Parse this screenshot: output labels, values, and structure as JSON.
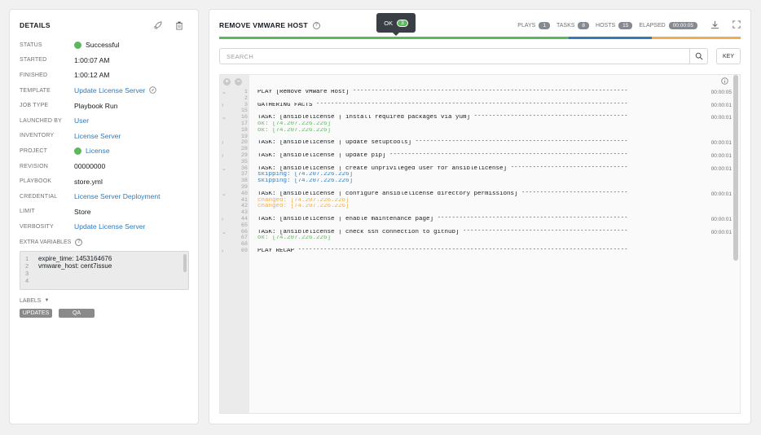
{
  "details": {
    "title": "DETAILS",
    "rows": [
      {
        "label": "STATUS",
        "value": "Successful",
        "type": "status"
      },
      {
        "label": "STARTED",
        "value": "1:00:07 AM",
        "type": "text"
      },
      {
        "label": "FINISHED",
        "value": "1:00:12 AM",
        "type": "text"
      },
      {
        "label": "TEMPLATE",
        "value": "Update License Server",
        "type": "link-compass"
      },
      {
        "label": "JOB TYPE",
        "value": "Playbook Run",
        "type": "text"
      },
      {
        "label": "LAUNCHED BY",
        "value": "User",
        "type": "link"
      },
      {
        "label": "INVENTORY",
        "value": "License Server",
        "type": "link"
      },
      {
        "label": "PROJECT",
        "value": "License",
        "type": "link-status"
      },
      {
        "label": "REVISION",
        "value": "00000000",
        "type": "text"
      },
      {
        "label": "PLAYBOOK",
        "value": "store.yml",
        "type": "text"
      },
      {
        "label": "CREDENTIAL",
        "value": "License Server Deployment",
        "type": "link"
      },
      {
        "label": "LIMIT",
        "value": "Store",
        "type": "text"
      },
      {
        "label": "VERBOSITY",
        "value": "Update License Server",
        "type": "link"
      }
    ],
    "extra_variables_label": "EXTRA VARIABLES",
    "extra_variables": [
      {
        "ln": "1",
        "text": "expire_time: 1453164676"
      },
      {
        "ln": "2",
        "text": "vmware_host: cent7issue"
      },
      {
        "ln": "3",
        "text": ""
      },
      {
        "ln": "4",
        "text": ""
      }
    ],
    "labels_title": "LABELS",
    "labels": [
      "UPDATES",
      "QA"
    ]
  },
  "output": {
    "title": "REMOVE VMWARE HOST",
    "tooltip": {
      "label": "OK",
      "count": "3"
    },
    "plays_label": "PLAYS",
    "plays": "1",
    "tasks_label": "TASKS",
    "tasks": "8",
    "hosts_label": "HOSTS",
    "hosts": "15",
    "elapsed_label": "ELAPSED",
    "elapsed": "00:00:05",
    "search_placeholder": "SEARCH",
    "key_label": "KEY",
    "colors": {
      "ok": "#5cb85c",
      "skipped": "#337ab7",
      "changed": "#f0ad4e"
    },
    "progress": [
      {
        "status": "ok",
        "fraction": 0.67
      },
      {
        "status": "skipped",
        "fraction": 0.16
      },
      {
        "status": "changed",
        "fraction": 0.17
      }
    ],
    "lines": [
      {
        "chev": "⌄",
        "ln": "1",
        "text": "PLAY [Remove VMWare Host] ***************************************************************************",
        "time": "00:00:05",
        "cls": ""
      },
      {
        "chev": "",
        "ln": "2",
        "text": "",
        "time": "",
        "cls": ""
      },
      {
        "chev": "›",
        "ln": "3",
        "text": "GATHERING FACTS *************************************************************************************",
        "time": "00:00:01",
        "cls": ""
      },
      {
        "chev": "",
        "ln": "15",
        "text": "",
        "time": "",
        "cls": ""
      },
      {
        "chev": "⌄",
        "ln": "16",
        "text": "TASK: [ansiblelicense | install required packages via yum] ******************************************",
        "time": "00:00:01",
        "cls": ""
      },
      {
        "chev": "",
        "ln": "17",
        "text": "ok: [74.207.226.226]",
        "time": "",
        "cls": "ok"
      },
      {
        "chev": "",
        "ln": "18",
        "text": "ok: [74.207.226.226]",
        "time": "",
        "cls": "ok"
      },
      {
        "chev": "",
        "ln": "19",
        "text": "",
        "time": "",
        "cls": ""
      },
      {
        "chev": "›",
        "ln": "20",
        "text": "TASK: [ansiblelicense | update setuptools] **********************************************************",
        "time": "00:00:01",
        "cls": ""
      },
      {
        "chev": "",
        "ln": "28",
        "text": "",
        "time": "",
        "cls": ""
      },
      {
        "chev": "›",
        "ln": "29",
        "text": "TASK: [ansiblelicense | update pip] *****************************************************************",
        "time": "00:00:01",
        "cls": ""
      },
      {
        "chev": "",
        "ln": "35",
        "text": "",
        "time": "",
        "cls": ""
      },
      {
        "chev": "⌄",
        "ln": "36",
        "text": "TASK: [ansiblelicense | create unprivileged user for ansiblelicense] ********************************",
        "time": "00:00:01",
        "cls": ""
      },
      {
        "chev": "",
        "ln": "37",
        "text": "skipping: [74.207.226.226]",
        "time": "",
        "cls": "skip"
      },
      {
        "chev": "",
        "ln": "38",
        "text": "skipping: [74.207.226.226]",
        "time": "",
        "cls": "skip"
      },
      {
        "chev": "",
        "ln": "39",
        "text": "",
        "time": "",
        "cls": ""
      },
      {
        "chev": "⌄",
        "ln": "40",
        "text": "TASK: [ansiblelicense | configure ansiblelicense directory permissions] *****************************",
        "time": "00:00:01",
        "cls": ""
      },
      {
        "chev": "",
        "ln": "41",
        "text": "changed: [74.207.226.226]",
        "time": "",
        "cls": "chg"
      },
      {
        "chev": "",
        "ln": "42",
        "text": "changed: [74.207.226.226]",
        "time": "",
        "cls": "chg"
      },
      {
        "chev": "",
        "ln": "43",
        "text": "",
        "time": "",
        "cls": ""
      },
      {
        "chev": "›",
        "ln": "44",
        "text": "TASK: [ansiblelicense | enable maintenance page] ****************************************************",
        "time": "00:00:01",
        "cls": ""
      },
      {
        "chev": "",
        "ln": "65",
        "text": "",
        "time": "",
        "cls": ""
      },
      {
        "chev": "⌄",
        "ln": "66",
        "text": "TASK: [ansiblelicense | check ssh connection to github] *********************************************",
        "time": "00:00:01",
        "cls": ""
      },
      {
        "chev": "",
        "ln": "67",
        "text": "ok: [74.207.226.226]",
        "time": "",
        "cls": "ok"
      },
      {
        "chev": "",
        "ln": "68",
        "text": "",
        "time": "",
        "cls": ""
      },
      {
        "chev": "›",
        "ln": "69",
        "text": "PLAY RECAP ******************************************************************************************",
        "time": "",
        "cls": ""
      }
    ]
  }
}
